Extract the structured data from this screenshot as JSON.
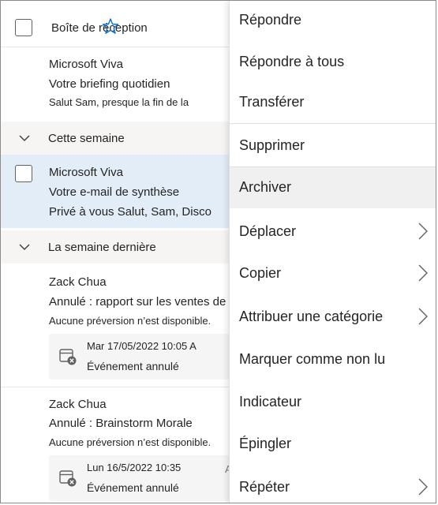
{
  "header": {
    "folder_title": "Boîte de réception"
  },
  "messages": [
    {
      "sender": "Microsoft Viva",
      "subject": "Votre briefing quotidien",
      "preview": "Salut Sam, presque la fin de la"
    },
    {
      "sender": "Microsoft Viva",
      "subject": "Votre e-mail de synthèse",
      "preview": "Privé à vous Salut, Sam, Disco"
    },
    {
      "sender": "Zack Chua",
      "subject": "Annulé : rapport sur les ventes de préparation",
      "preview": "Aucune préversion n’est disponible.",
      "event_date": "Mar 17/05/2022 10:05 A",
      "event_status": "Événement annulé"
    },
    {
      "sender": "Zack Chua",
      "subject": "Annulé : Brainstorm Morale",
      "preview": "Aucune préversion n’est disponible.",
      "event_date": "Lun 16/5/2022 10:35",
      "event_suffix": "A",
      "event_status": "Événement annulé"
    }
  ],
  "groups": {
    "this_week": "Cette semaine",
    "last_week": "La semaine dernière"
  },
  "context_menu": {
    "items": [
      {
        "label": "Répondre"
      },
      {
        "label": "Répondre à tous"
      },
      {
        "label": "Transférer"
      },
      {
        "label": "Supprimer"
      },
      {
        "label": "Archiver",
        "highlighted": true
      },
      {
        "label": "Déplacer",
        "submenu": true
      },
      {
        "label": "Copier",
        "submenu": true
      },
      {
        "label": "Attribuer une catégorie",
        "submenu": true
      },
      {
        "label": "Marquer comme non lu"
      },
      {
        "label": "Indicateur"
      },
      {
        "label": "Épingler"
      },
      {
        "label": "Répéter",
        "submenu": true
      }
    ]
  },
  "colors": {
    "selected_row": "#e3edf7",
    "group_header": "#f6f5f4",
    "menu_hover": "#f0f0f0",
    "accent": "#0f6cbd"
  }
}
